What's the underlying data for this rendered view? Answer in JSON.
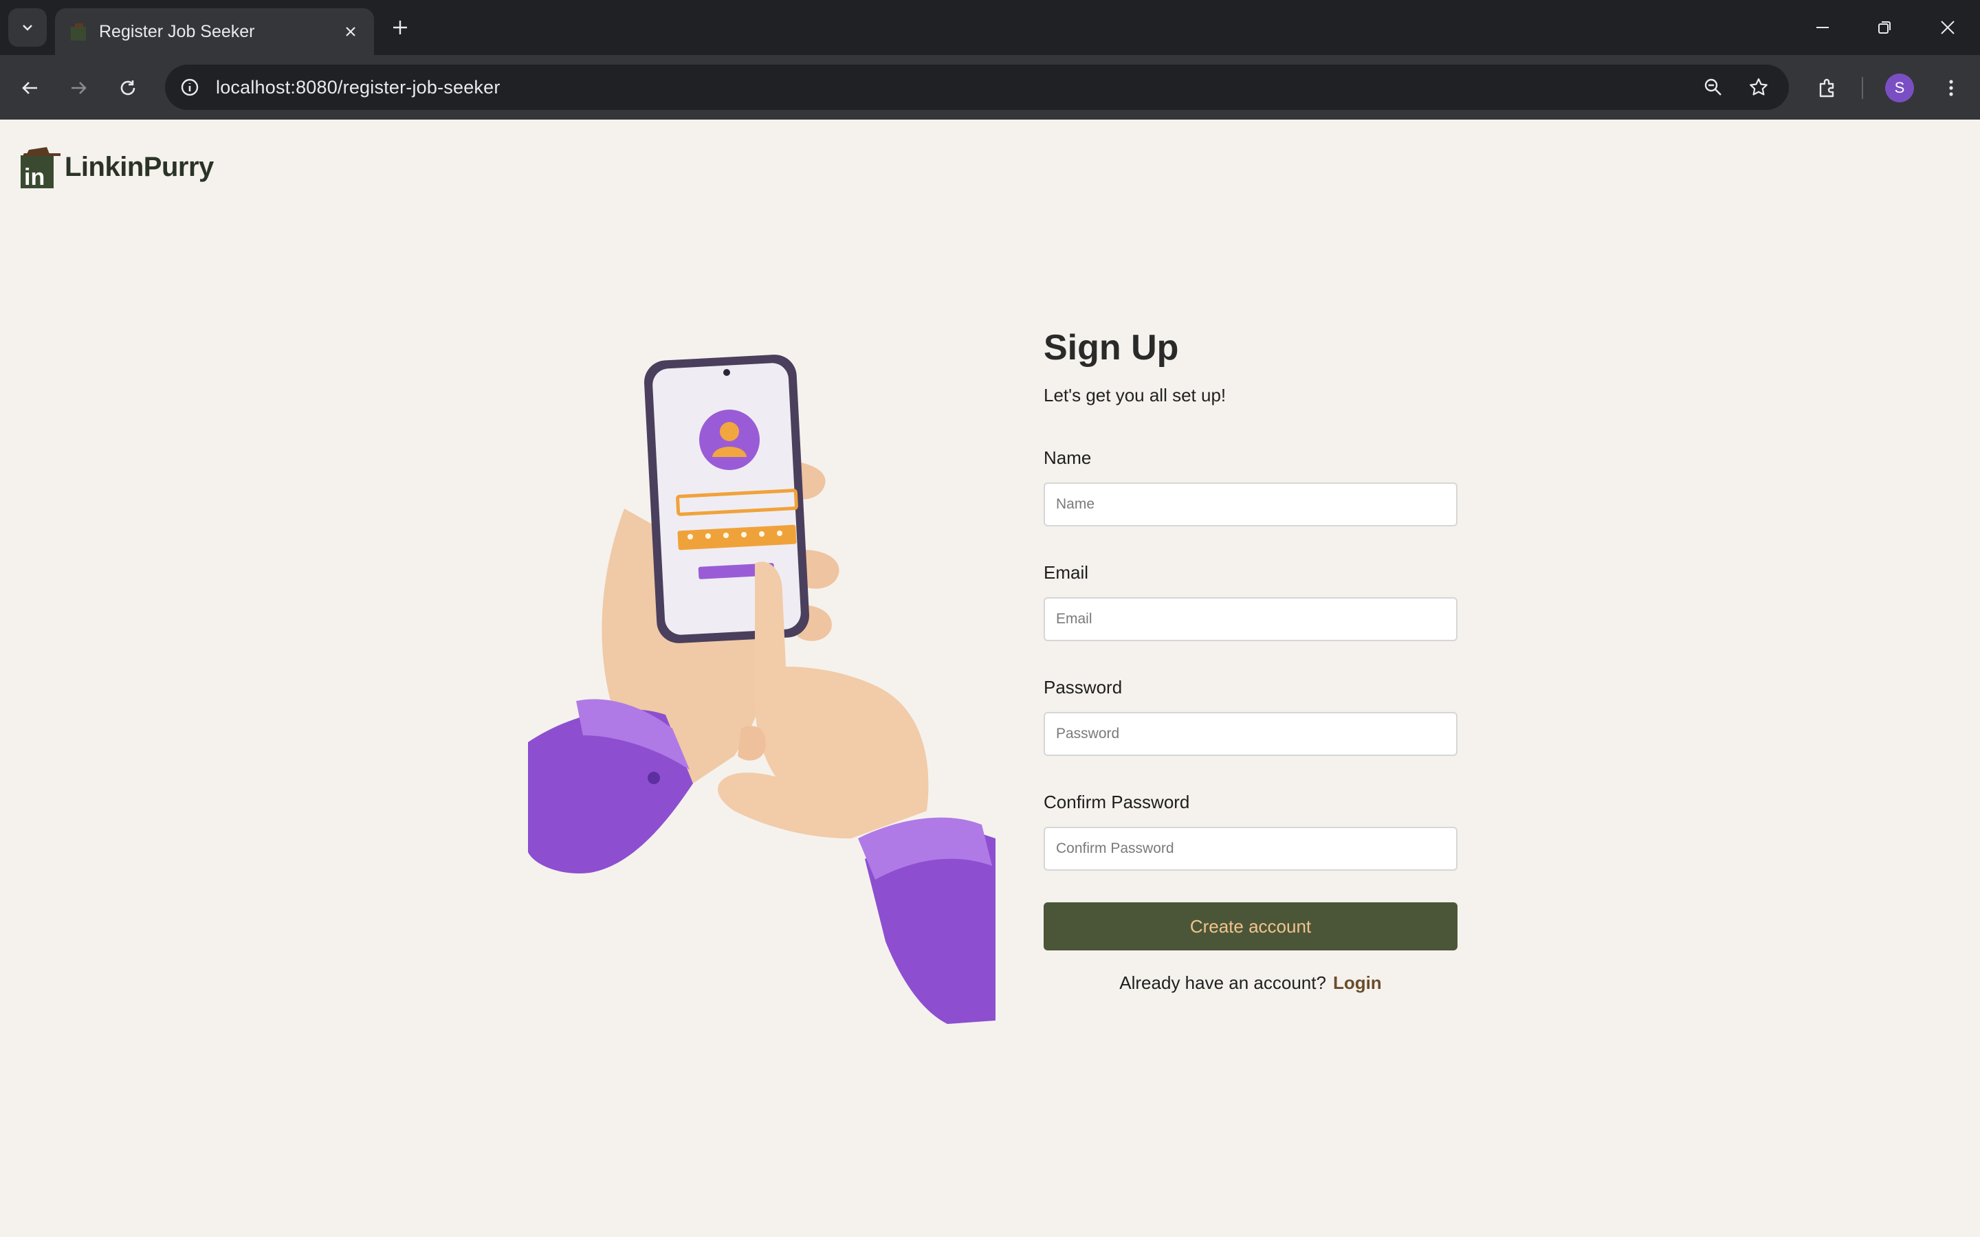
{
  "browser": {
    "tab_title": "Register Job Seeker",
    "url": "localhost:8080/register-job-seeker",
    "profile_initial": "S",
    "icons": [
      "tab-list-icon",
      "favicon-icon",
      "close-tab-icon",
      "new-tab-icon",
      "minimize-icon",
      "restore-icon",
      "close-window-icon",
      "back-icon",
      "forward-icon",
      "reload-icon",
      "site-info-icon",
      "zoom-icon",
      "bookmark-star-icon",
      "extensions-icon",
      "menu-dots-icon"
    ]
  },
  "brand": {
    "name": "LinkinPurry",
    "mark": "in"
  },
  "signup": {
    "title": "Sign Up",
    "subtitle": "Let's get you all set up!",
    "name_label": "Name",
    "name_placeholder": "Name",
    "email_label": "Email",
    "email_placeholder": "Email",
    "password_label": "Password",
    "password_placeholder": "Password",
    "confirm_label": "Confirm Password",
    "confirm_placeholder": "Confirm Password",
    "submit_label": "Create account",
    "already_text": "Already have an account?",
    "login_link": "Login"
  },
  "colors": {
    "page_bg": "#f5f2ed",
    "button_bg": "#4b5639",
    "button_text": "#f2c48a",
    "login_link": "#6a4d2b",
    "accent_purple": "#8e5bd6"
  }
}
